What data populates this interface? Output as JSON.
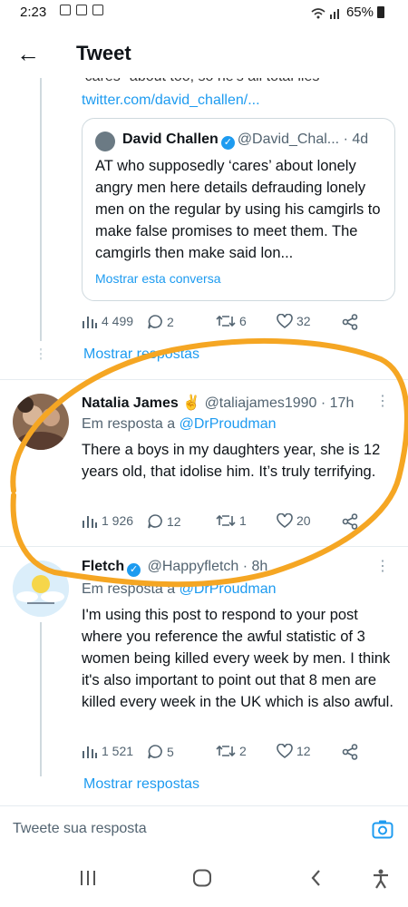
{
  "statusbar": {
    "time": "2:23",
    "battery": "65%"
  },
  "appbar": {
    "title": "Tweet"
  },
  "top_tweet": {
    "clipped_text": "\"cares\" about too, so he's all total lies",
    "link": "twitter.com/david_challen/...",
    "quote": {
      "author": "David Challen",
      "handle": "@David_Chal...",
      "time": "· 4d",
      "text": "AT who supposedly ‘cares’ about lonely angry men here details defrauding lonely men on the regular by using his camgirls to make false promises to meet them. The camgirls then make said lon...",
      "show_thread": "Mostrar esta conversa"
    },
    "stats": {
      "views": "4 499",
      "replies": "2",
      "retweets": "6",
      "likes": "32"
    },
    "show_replies": "Mostrar respostas"
  },
  "tweets": [
    {
      "author": "Natalia James ✌️",
      "handle": "@taliajames1990 · 17h",
      "reply_prefix": "Em resposta a",
      "reply_to": "@DrProudman",
      "text": "There a boys in my daughters year, she is 12 years old, that idolise him. It’s truly terrifying.",
      "stats": {
        "views": "1 926",
        "replies": "12",
        "retweets": "1",
        "likes": "20"
      }
    },
    {
      "author": "Fletch",
      "handle": "@Happyfletch · 8h",
      "reply_prefix": "Em resposta a",
      "reply_to": "@DrProudman",
      "text": "I'm using this post to respond to your post where you reference the awful statistic of 3 women being killed every week by men. I think it's also important to point out that 8 men are killed every week in the UK which is also awful.",
      "stats": {
        "views": "1 521",
        "replies": "5",
        "retweets": "2",
        "likes": "12"
      },
      "show_replies": "Mostrar respostas"
    }
  ],
  "reply_bar": {
    "placeholder": "Tweete sua resposta"
  },
  "colors": {
    "link": "#1d9bf0",
    "annotation": "#f5a623",
    "muted": "#536471"
  }
}
